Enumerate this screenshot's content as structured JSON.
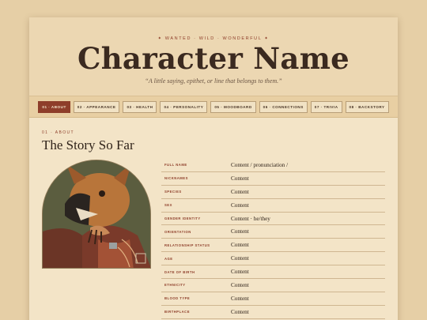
{
  "header": {
    "tagline": "✦ WANTED · WILD · WONDERFUL ✦",
    "title": "Character Name",
    "subtitle": "“A little saying, epithet, or line that belongs to them.”"
  },
  "nav": {
    "tabs": [
      {
        "label": "01 · ABOUT",
        "active": true
      },
      {
        "label": "02 · APPEARANCE",
        "active": false
      },
      {
        "label": "03 · HEALTH",
        "active": false
      },
      {
        "label": "04 · PERSONALITY",
        "active": false
      },
      {
        "label": "05 · MOODBOARD",
        "active": false
      },
      {
        "label": "06 · CONNECTIONS",
        "active": false
      },
      {
        "label": "07 · TRIVIA",
        "active": false
      },
      {
        "label": "08 · BACKSTORY",
        "active": false
      }
    ]
  },
  "section": {
    "kicker": "01 · ABOUT",
    "title": "The Story So Far"
  },
  "profile": {
    "rows": [
      {
        "label": "FULL NAME",
        "value": "Content / pronunciation /"
      },
      {
        "label": "NICKNAMES",
        "value": "Content"
      },
      {
        "label": "SPECIES",
        "value": "Content"
      },
      {
        "label": "SEX",
        "value": "Content"
      },
      {
        "label": "GENDER IDENTITY",
        "value": "Content · he/they"
      },
      {
        "label": "ORIENTATION",
        "value": "Content"
      },
      {
        "label": "RELATIONSHIP STATUS",
        "value": "Content"
      },
      {
        "label": "AGE",
        "value": "Content"
      },
      {
        "label": "DATE OF BIRTH",
        "value": "Content"
      },
      {
        "label": "ETHNICITY",
        "value": "Content"
      },
      {
        "label": "BLOOD TYPE",
        "value": "Content"
      },
      {
        "label": "BIRTHPLACE",
        "value": "Content"
      }
    ]
  },
  "colors": {
    "accent": "#8e3e2a",
    "paper": "#f3e4c7",
    "header": "#ecd7b2",
    "ink": "#3b2a20"
  }
}
